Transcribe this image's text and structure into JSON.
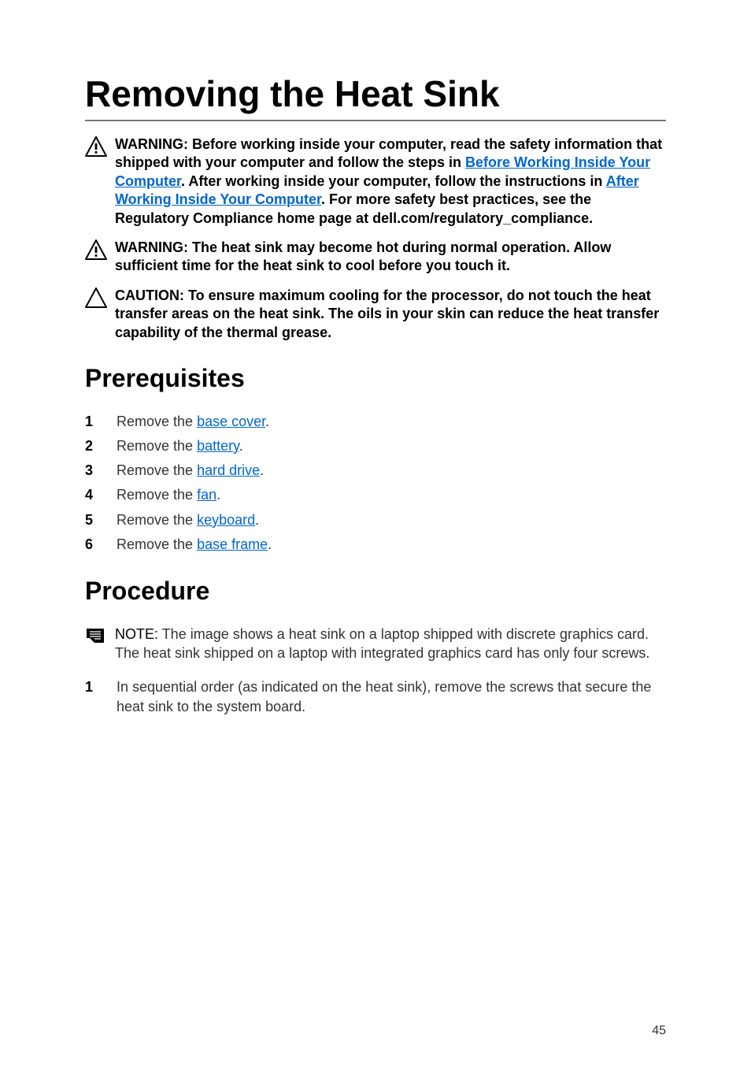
{
  "title": "Removing the Heat Sink",
  "notices": {
    "warn1": {
      "pre": "WARNING: Before working inside your computer, read the safety information that shipped with your computer and follow the steps in ",
      "link1": "Before Working Inside Your Computer",
      "mid": ". After working inside your computer, follow the instructions in ",
      "link2": "After Working Inside Your Computer",
      "post": ". For more safety best practices, see the Regulatory Compliance home page at dell.com/regulatory_compliance."
    },
    "warn2": "WARNING: The heat sink may become hot during normal operation. Allow sufficient time for the heat sink to cool before you touch it.",
    "caution": "CAUTION: To ensure maximum cooling for the processor, do not touch the heat transfer areas on the heat sink. The oils in your skin can reduce the heat transfer capability of the thermal grease."
  },
  "sections": {
    "prereq_title": "Prerequisites",
    "prereq_items": [
      {
        "pre": "Remove the ",
        "link": "base cover",
        "post": "."
      },
      {
        "pre": "Remove the ",
        "link": "battery",
        "post": "."
      },
      {
        "pre": "Remove the ",
        "link": "hard drive",
        "post": "."
      },
      {
        "pre": "Remove the ",
        "link": "fan",
        "post": "."
      },
      {
        "pre": "Remove the ",
        "link": "keyboard",
        "post": "."
      },
      {
        "pre": "Remove the ",
        "link": "base frame",
        "post": "."
      }
    ],
    "proc_title": "Procedure",
    "proc_note": {
      "label": "NOTE: ",
      "text": "The image shows a heat sink on a laptop shipped with discrete graphics card. The heat sink shipped on a laptop with integrated graphics card has only four screws."
    },
    "proc_items": [
      {
        "text": "In sequential order (as indicated on the heat sink), remove the screws that secure the heat sink to the system board."
      }
    ]
  },
  "page_number": "45"
}
